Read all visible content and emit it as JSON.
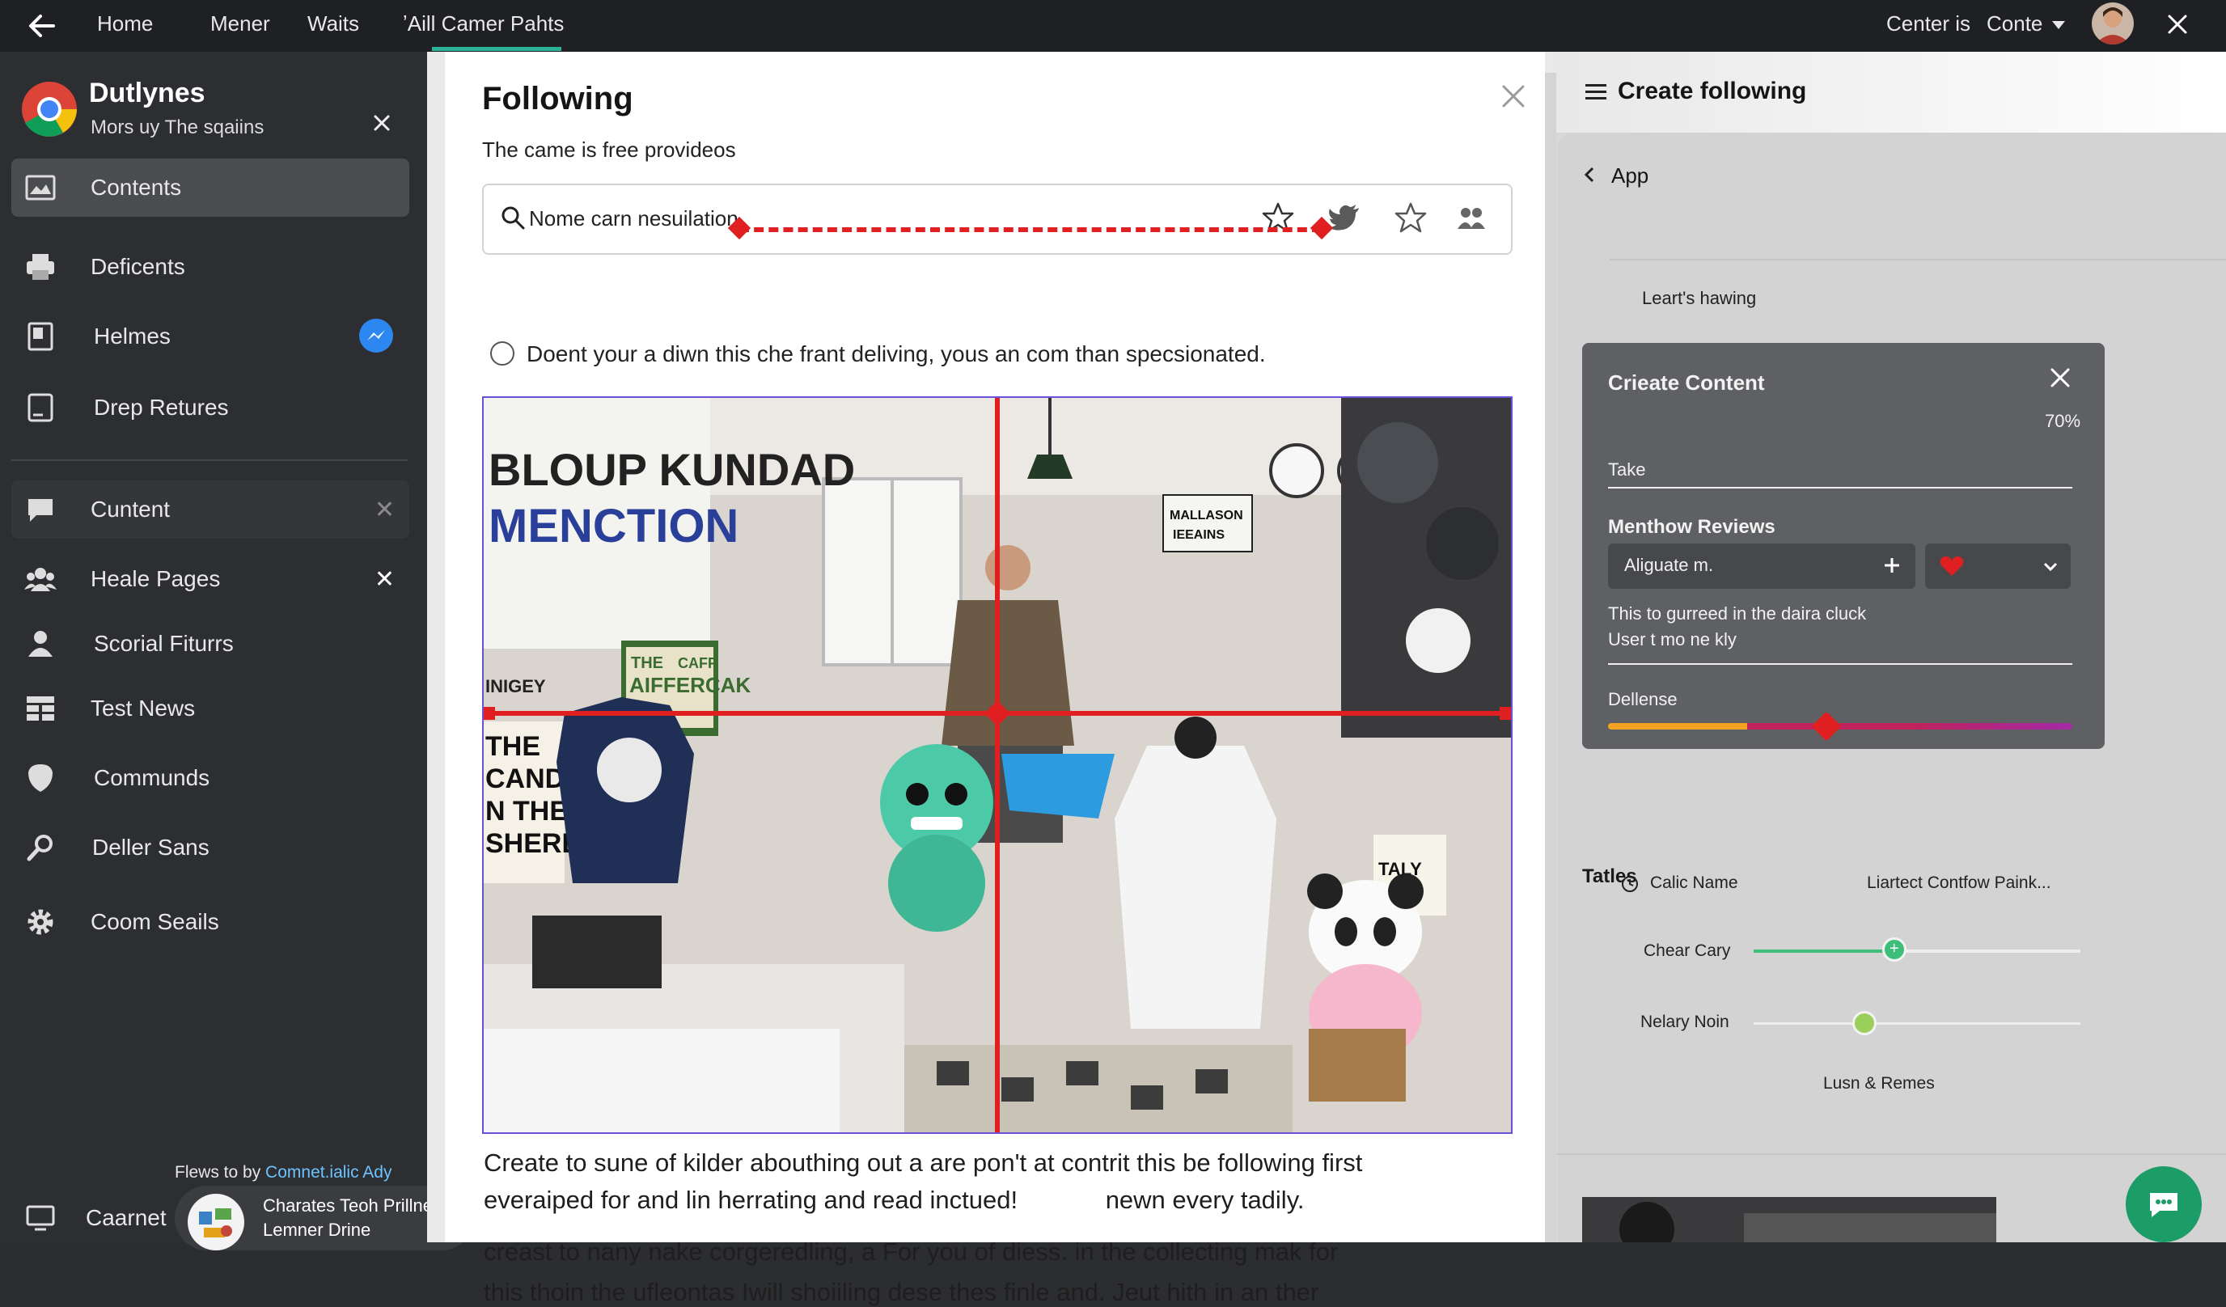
{
  "topbar": {
    "nav": [
      "Home",
      "Mener",
      "Waits",
      "ʼAill Camer Pahts"
    ],
    "right": [
      "Center is",
      "Conte"
    ]
  },
  "sidebar": {
    "profile_name": "Dutlynes",
    "profile_sub": "Mors uy The sqaiins",
    "items": [
      {
        "label": "Contents"
      },
      {
        "label": "Deficents"
      },
      {
        "label": "Helmes"
      },
      {
        "label": "Drep Retures"
      },
      {
        "label": "Cuntent"
      },
      {
        "label": "Heale Pages"
      },
      {
        "label": "Scorial Fiturrs"
      },
      {
        "label": "Test News"
      },
      {
        "label": "Communds"
      },
      {
        "label": "Deller Sans"
      },
      {
        "label": "Coom Seails"
      }
    ],
    "footer_text": "Flews to by",
    "footer_link": "Comnet.ialic Ady",
    "bottom_item": "Caarnet",
    "promo_line1": "Charates Teoh Prillner",
    "promo_line2": "Lemner Drine"
  },
  "main": {
    "title": "Following",
    "subtitle": "The came is free provideos",
    "search_value": "Nome carn nesuilation",
    "radio_label": "Doent your a diwn this che frant deliving, yous an com than specsionated.",
    "para1_line1": "Create to sune of kilder abouthing out a are pon't at contrit this be following first",
    "para1_line2a": "everaiped for and lin herrating and read inctued!",
    "para1_line2b": "newn every tadily.",
    "para2_line1": "creast to nany nake corgeredling, a For you of diess. in the collecting mak for",
    "para2_line2": "this thoin the ufleontas Iwill shoiiling dese thes finle and. Jeut hith in an ther",
    "image_signs": {
      "sign1": "BLOUP KUNDAD",
      "sign2": "MENCTION",
      "sign3a": "THE",
      "sign3b": "CAFF",
      "sign3c": "AIFFERCAK",
      "sign4": "INIGEY",
      "sign5a": "THE",
      "sign5b": "CAND",
      "sign5c": "N THE",
      "sign5d": "SHERE",
      "sign6a": "MALLASON",
      "sign6b": "IEEAINS",
      "sign7": "TALY"
    }
  },
  "right": {
    "header": "Create following",
    "back_label": "App",
    "sub_label": "Leart's hawing",
    "create_card": {
      "title": "Crieate Content",
      "percent": "70%",
      "take_label": "Take",
      "reviews_label": "Menthow Reviews",
      "select_value": "Aliguate m.",
      "desc1": "This to gurreed in the daira cluck",
      "desc2": "User t mo ne kly",
      "slider_label": "Dellense",
      "slider_value": 0.47
    },
    "tatles": {
      "title": "Tatles",
      "name_label": "Calic Name",
      "name_value": "Liartect Contfow Paink...",
      "slider1_label": "Chear Cary",
      "slider1_value": 0.43,
      "slider2_label": "Nelary Noin",
      "slider2_value": 0.34,
      "footer": "Lusn & Remes"
    }
  },
  "colors": {
    "accent_red": "#e02020",
    "green_slider": "#3dbf79",
    "blue_badge": "#2d87f0",
    "chat_green": "#1c9c66"
  }
}
